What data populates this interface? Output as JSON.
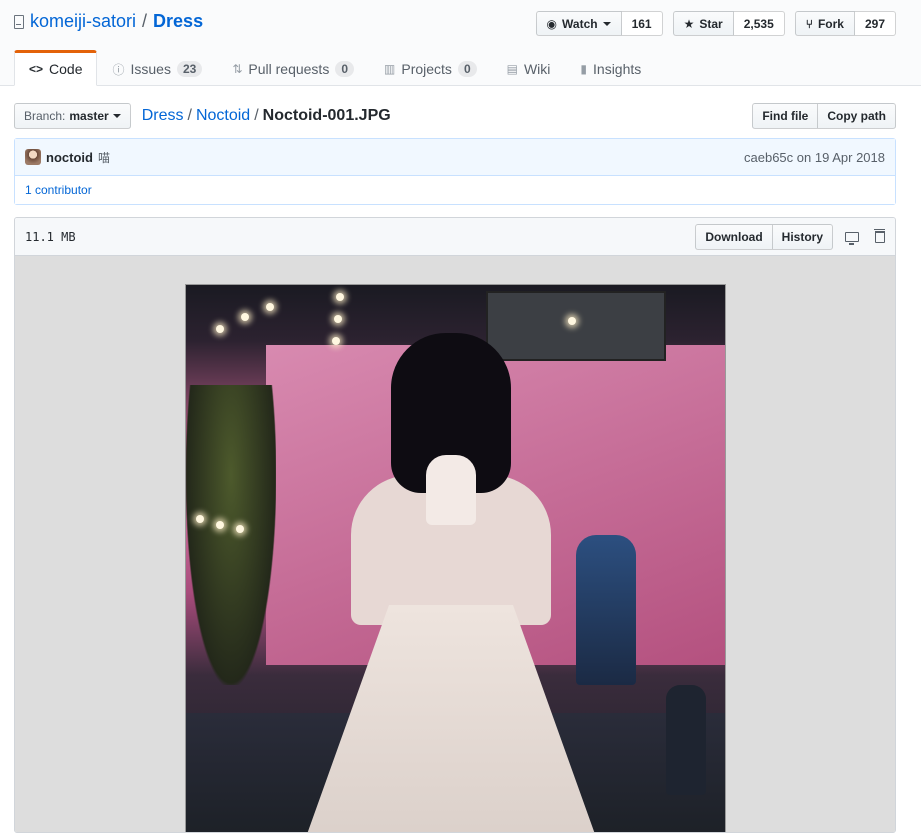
{
  "repo": {
    "owner": "komeiji-satori",
    "name": "Dress"
  },
  "actions": {
    "watch": {
      "label": "Watch",
      "count": "161"
    },
    "star": {
      "label": "Star",
      "count": "2,535"
    },
    "fork": {
      "label": "Fork",
      "count": "297"
    }
  },
  "tabs": [
    {
      "label": "Code",
      "icon": "code-icon"
    },
    {
      "label": "Issues",
      "count": "23",
      "icon": "issue-icon"
    },
    {
      "label": "Pull requests",
      "count": "0",
      "icon": "pull-request-icon"
    },
    {
      "label": "Projects",
      "count": "0",
      "icon": "project-icon"
    },
    {
      "label": "Wiki",
      "icon": "book-icon"
    },
    {
      "label": "Insights",
      "icon": "graph-icon"
    }
  ],
  "branch": {
    "prefix": "Branch:",
    "name": "master"
  },
  "breadcrumb": {
    "root": "Dress",
    "folder": "Noctoid",
    "file": "Noctoid-001.JPG"
  },
  "file_actions": {
    "find": "Find file",
    "copy": "Copy path"
  },
  "commit": {
    "author": "noctoid",
    "message": "喵",
    "sha": "caeb65c",
    "date": "on 19 Apr 2018",
    "contributors": "1 contributor"
  },
  "file": {
    "size": "11.1 MB",
    "download": "Download",
    "history": "History"
  },
  "colors": {
    "accent": "#0366d6",
    "tab_highlight": "#e36209",
    "commit_bg": "#f1f8ff"
  }
}
